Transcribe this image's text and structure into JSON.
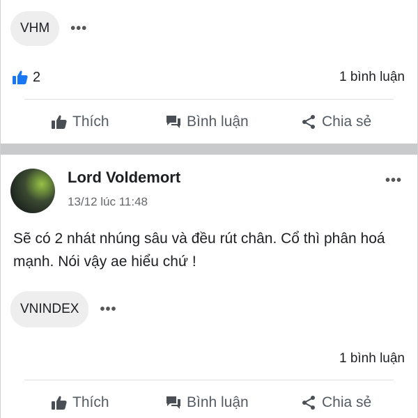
{
  "prev_post": {
    "tag": "VHM",
    "more": "•••",
    "like_count": "2",
    "comment_count": "1 bình luận"
  },
  "actions": {
    "like": "Thích",
    "comment": "Bình luận",
    "share": "Chia sẻ"
  },
  "post": {
    "author": "Lord Voldemort",
    "time": "13/12 lúc 11:48",
    "more": "•••",
    "text": "Sẽ có 2 nhát nhúng sâu và đều rút chân. Cổ thì phân hoá mạnh. Nói vậy ae hiểu chứ !",
    "tag": "VNINDEX",
    "tag_more": "•••",
    "comment_count": "1 bình luận"
  },
  "icons": {
    "like": "thumbs-up-icon",
    "comment": "chat-bubble-icon",
    "share": "share-icon",
    "like_accent": "#1877f2"
  }
}
